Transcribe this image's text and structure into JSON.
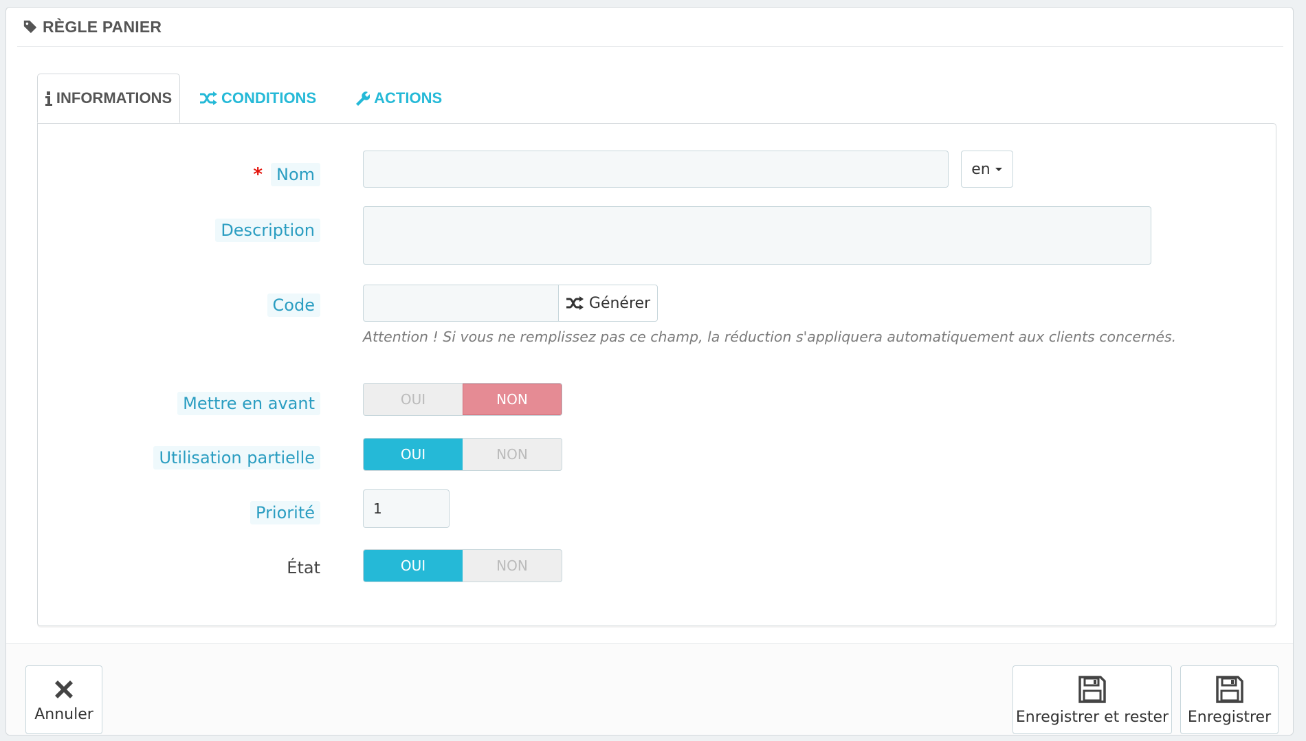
{
  "panel": {
    "title": "RÈGLE PANIER",
    "icon": "tag-icon"
  },
  "tabs": [
    {
      "label": "INFORMATIONS",
      "icon": "info-icon",
      "active": true
    },
    {
      "label": "CONDITIONS",
      "icon": "shuffle-icon",
      "active": false
    },
    {
      "label": "ACTIONS",
      "icon": "wrench-icon",
      "active": false
    }
  ],
  "form": {
    "name": {
      "label": "Nom",
      "required_mark": "*",
      "value": "",
      "language": "en"
    },
    "description": {
      "label": "Description",
      "value": ""
    },
    "code": {
      "label": "Code",
      "value": "",
      "generate_label": "Générer",
      "help": "Attention ! Si vous ne remplissez pas ce champ, la réduction s'appliquera automatiquement aux clients concernés."
    },
    "highlight": {
      "label": "Mettre en avant",
      "yes": "OUI",
      "no": "NON",
      "selected": "NON"
    },
    "partial_use": {
      "label": "Utilisation partielle",
      "yes": "OUI",
      "no": "NON",
      "selected": "OUI"
    },
    "priority": {
      "label": "Priorité",
      "value": "1"
    },
    "status": {
      "label": "État",
      "yes": "OUI",
      "no": "NON",
      "selected": "OUI"
    }
  },
  "footer": {
    "cancel_label": "Annuler",
    "save_stay_label": "Enregistrer et rester",
    "save_label": "Enregistrer"
  },
  "colors": {
    "accent": "#25b9d7",
    "danger": "#e58b94",
    "label_bg": "#eff9fc"
  }
}
